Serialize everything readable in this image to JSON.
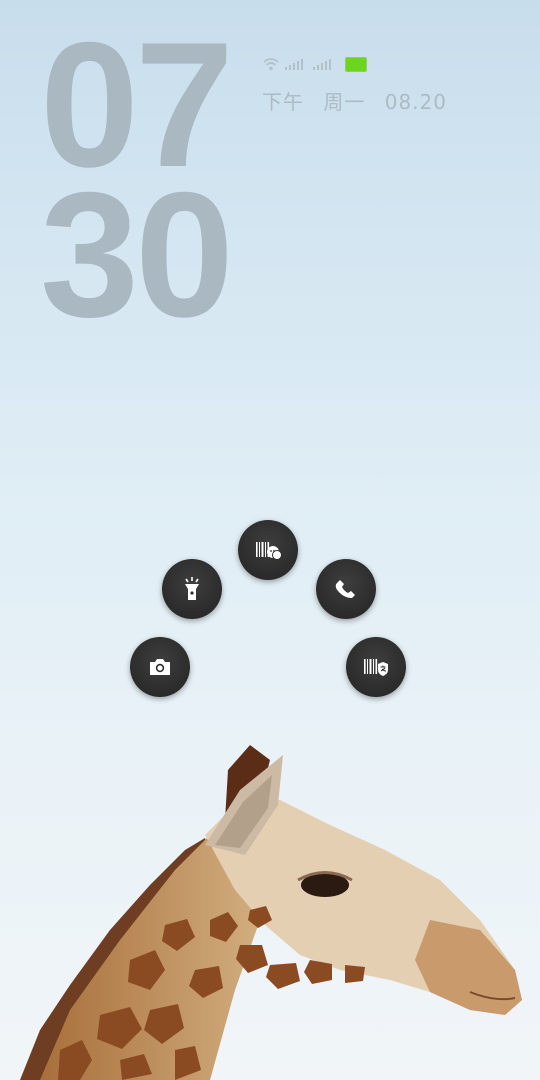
{
  "clock": {
    "hours": "07",
    "minutes": "30"
  },
  "date": {
    "period": "下午",
    "weekday": "周一",
    "date": "08.20"
  },
  "status": {
    "battery_color": "#6cd51e",
    "icons": [
      "wifi-icon",
      "signal-1-icon",
      "signal-2-icon",
      "battery-icon"
    ]
  },
  "shortcuts": [
    {
      "name": "camera",
      "icon": "camera-icon"
    },
    {
      "name": "flashlight",
      "icon": "flashlight-icon"
    },
    {
      "name": "wechat-pay",
      "icon": "wechat-pay-icon"
    },
    {
      "name": "phone",
      "icon": "phone-icon"
    },
    {
      "name": "alipay",
      "icon": "alipay-icon"
    }
  ]
}
